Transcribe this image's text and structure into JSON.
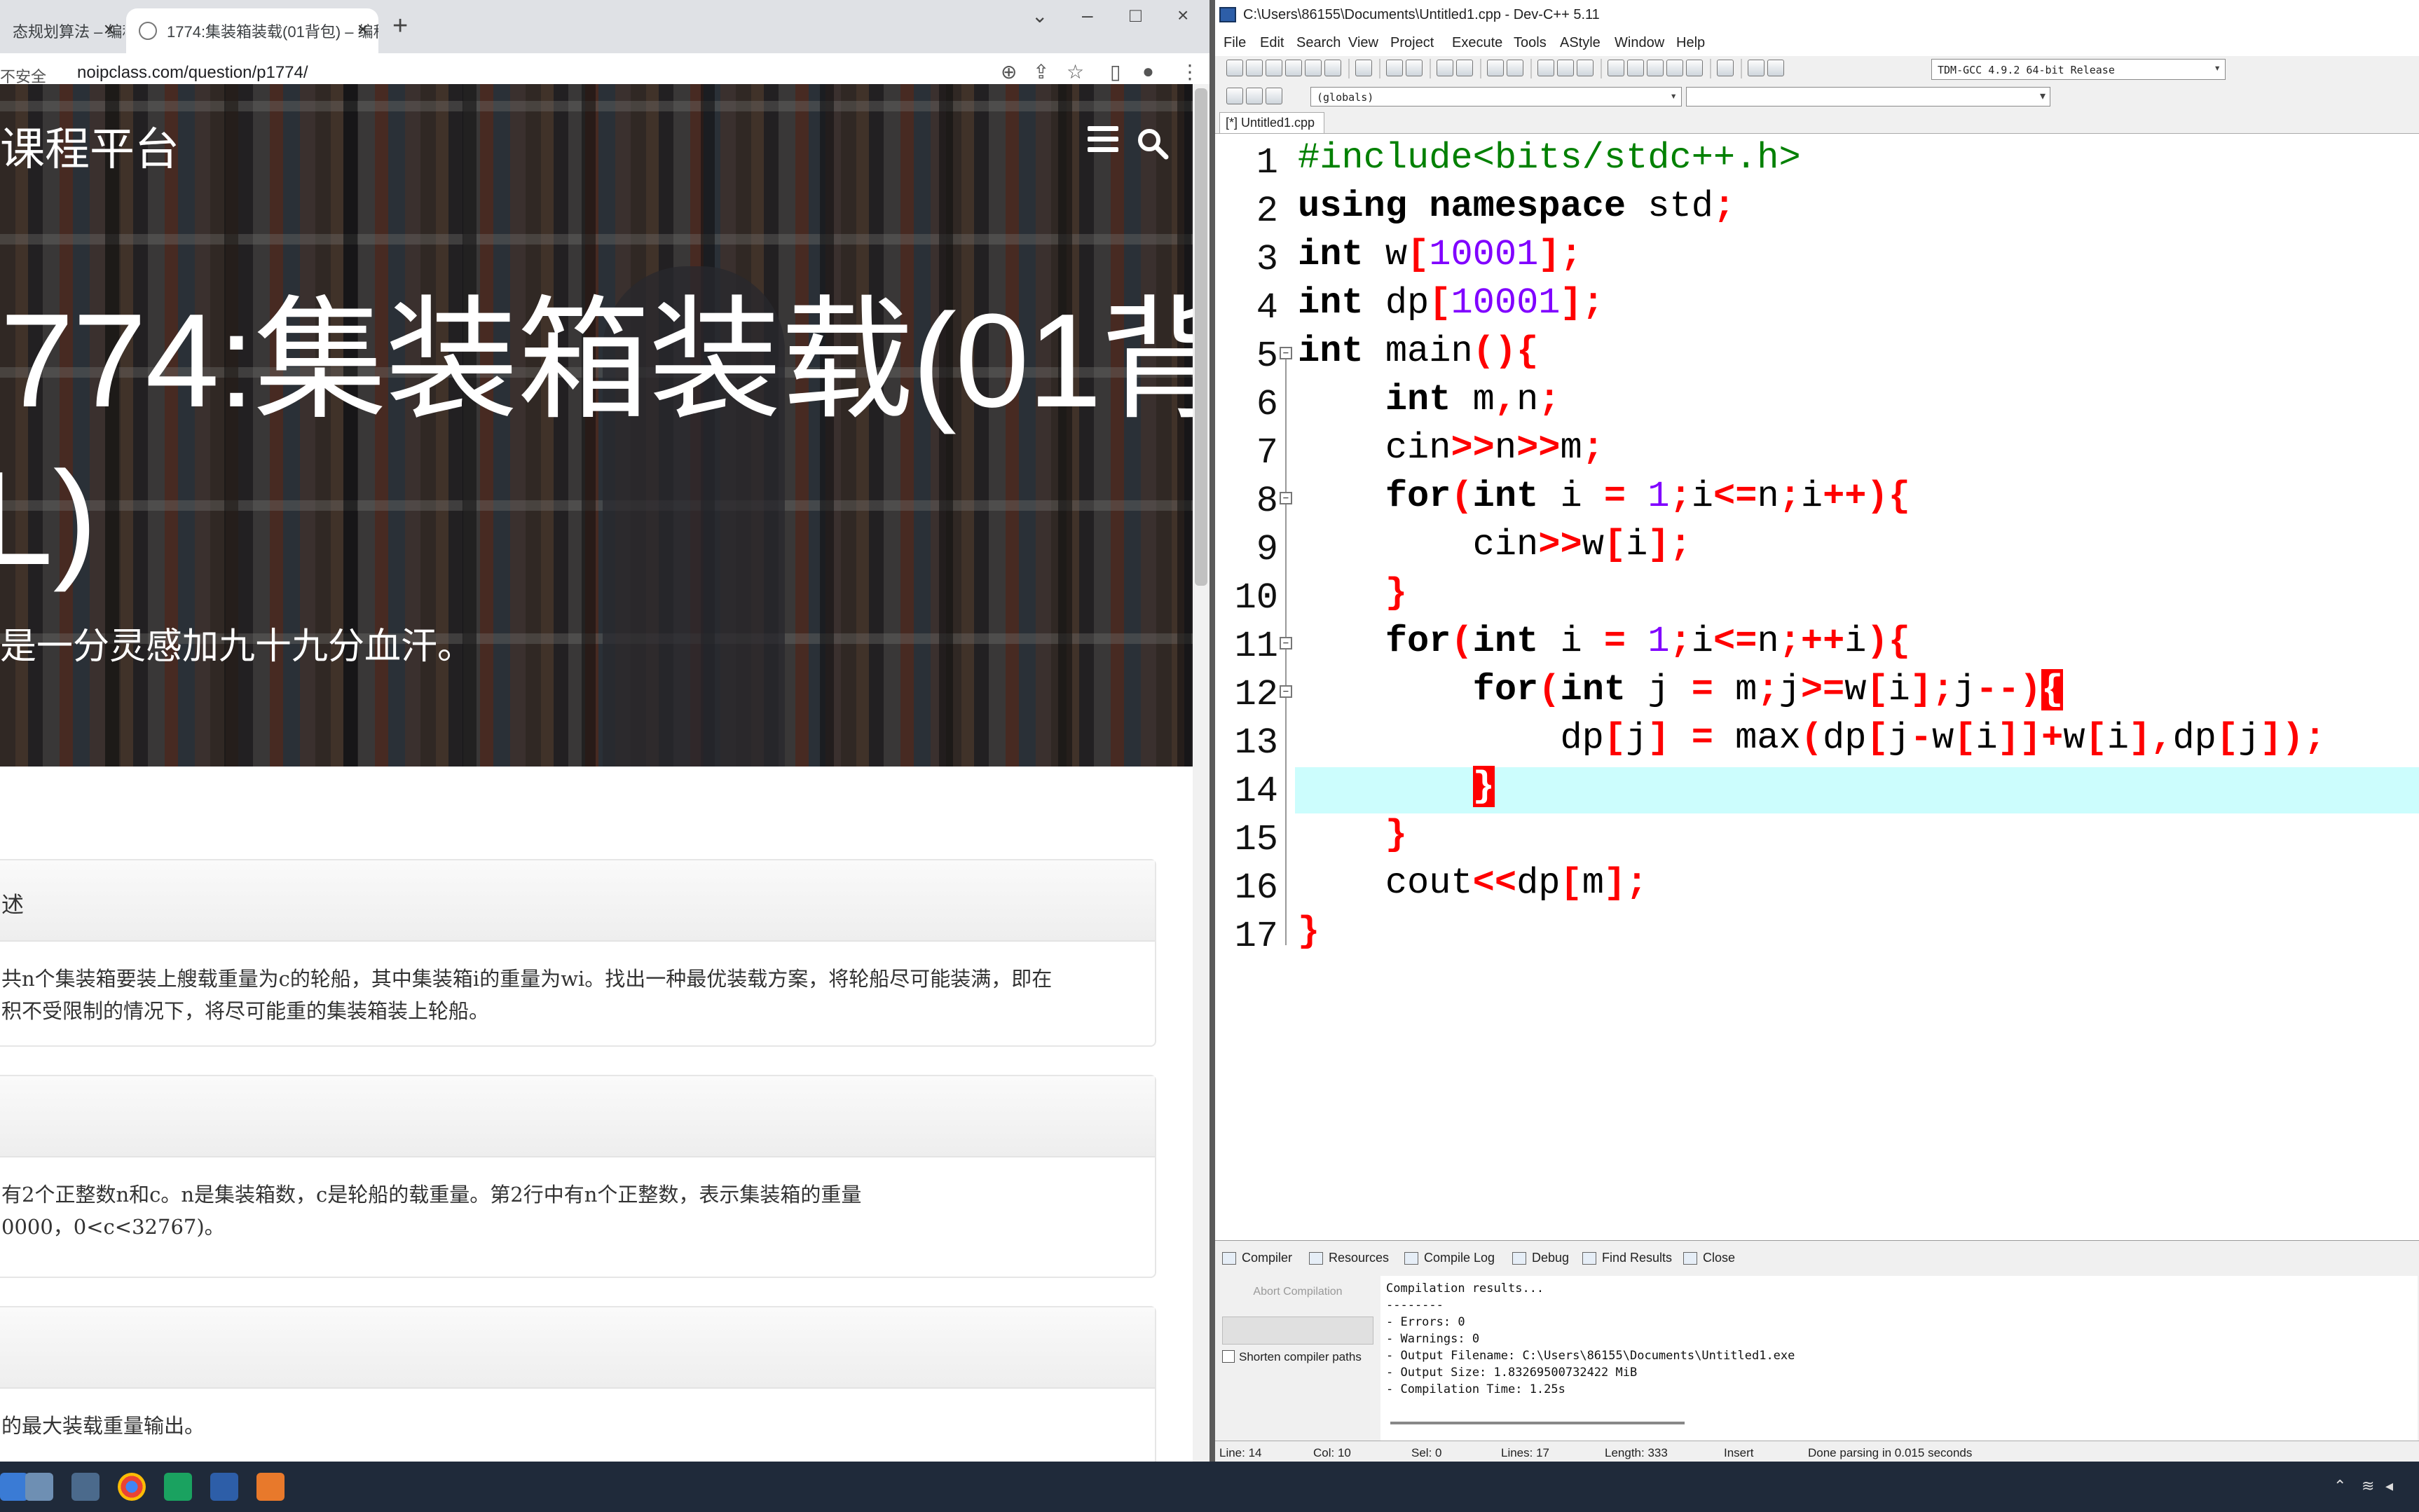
{
  "browser": {
    "tabs": [
      {
        "label": "态规划算法 – 编程"
      },
      {
        "label": "1774:集装箱装载(01背包) – 编程"
      }
    ],
    "new_tab_symbol": "+",
    "security_label": "不安全",
    "url": "noipclass.com/question/p1774/",
    "brand": "课程平台",
    "hero_title": "774:集装箱装载(01背",
    "hero_title_cont": "L)",
    "hero_subtitle": "是一分灵感加九十九分血汗。",
    "sections": [
      {
        "heading": "述",
        "lines": [
          "共n个集装箱要装上艘载重量为c的轮船，其中集装箱i的重量为wi。找出一种最优装载方案，将轮船尽可能装满，即在",
          "积不受限制的情况下，将尽可能重的集装箱装上轮船。"
        ]
      },
      {
        "heading": "",
        "lines": [
          "有2个正整数n和c。n是集装箱数，c是轮船的载重量。第2行中有n个正整数，表示集装箱的重量",
          "0000，0<c<32767)。"
        ]
      },
      {
        "heading": "",
        "lines": [
          "的最大装载重量输出。"
        ]
      }
    ]
  },
  "ide": {
    "title": "C:\\Users\\86155\\Documents\\Untitled1.cpp - Dev-C++ 5.11",
    "menu": [
      "File",
      "Edit",
      "Search",
      "View",
      "Project",
      "Execute",
      "Tools",
      "AStyle",
      "Window",
      "Help"
    ],
    "compiler": "TDM-GCC 4.9.2 64-bit Release",
    "scope": "(globals)",
    "file_tab": "[*] Untitled1.cpp",
    "line_numbers": [
      "1",
      "2",
      "3",
      "4",
      "5",
      "6",
      "7",
      "8",
      "9",
      "10",
      "11",
      "12",
      "13",
      "14",
      "15",
      "16",
      "17"
    ],
    "current_line": 14,
    "bottom_tabs": [
      "Compiler",
      "Resources",
      "Compile Log",
      "Debug",
      "Find Results",
      "Close"
    ],
    "abort_label": "Abort Compilation",
    "shorten_label": "Shorten compiler paths",
    "log": "Compilation results...\n--------\n- Errors: 0\n- Warnings: 0\n- Output Filename: C:\\Users\\86155\\Documents\\Untitled1.exe\n- Output Size: 1.83269500732422 MiB\n- Compilation Time: 1.25s",
    "status": {
      "line": "Line:   14",
      "col": "Col:   10",
      "sel": "Sel:   0",
      "lines": "Lines:   17",
      "length": "Length:   333",
      "mode": "Insert",
      "message": "Done parsing in 0.015 seconds"
    }
  },
  "colors": {
    "preprocessor": "#008000",
    "number": "#8000ff",
    "symbol": "#ff0000",
    "current_line_bg": "#ccfdfd",
    "taskbar": "#1f2a3a"
  }
}
